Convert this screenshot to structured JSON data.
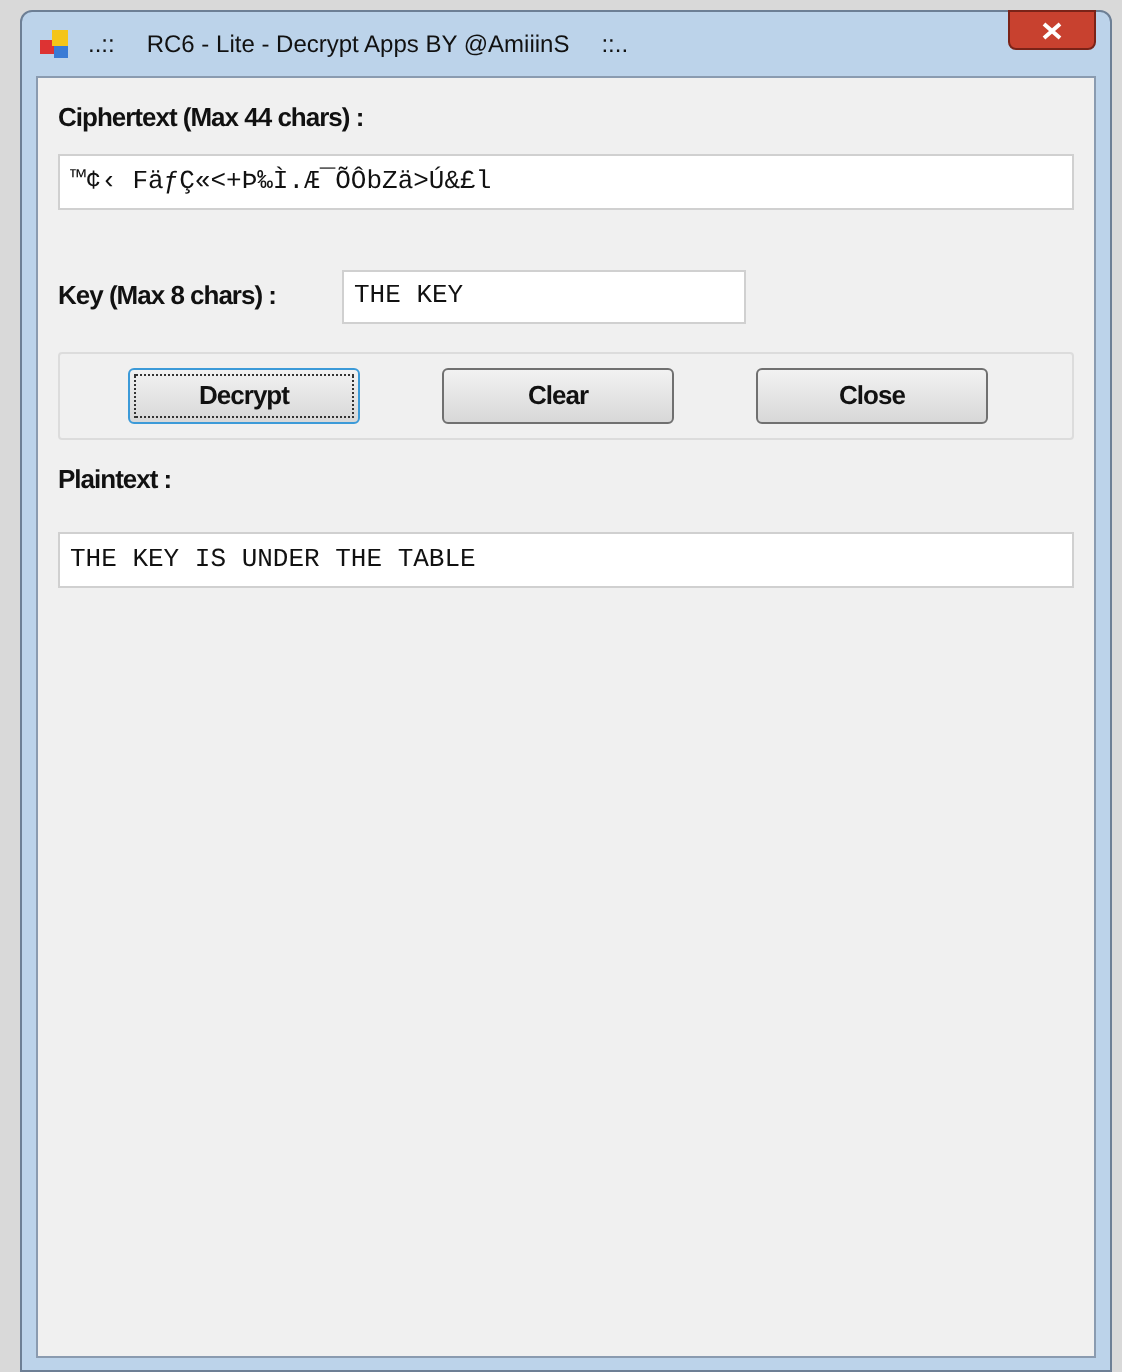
{
  "window": {
    "title_prefix": "..::",
    "title": "RC6 - Lite - Decrypt Apps BY @AmiiinS",
    "title_suffix": "::.."
  },
  "ciphertext": {
    "label": "Ciphertext (Max 44 chars) :",
    "value": "™¢‹ FäƒÇ«<+Þ‰Ì.Æ¯ÕÔbZä>Ú&£l"
  },
  "key": {
    "label": "Key (Max 8 chars) :",
    "value": "THE KEY"
  },
  "buttons": [
    {
      "label": "Decrypt",
      "focused": true
    },
    {
      "label": "Clear",
      "focused": false
    },
    {
      "label": "Close",
      "focused": false
    }
  ],
  "plaintext": {
    "label": "Plaintext :",
    "value": "THE KEY IS UNDER THE TABLE"
  }
}
